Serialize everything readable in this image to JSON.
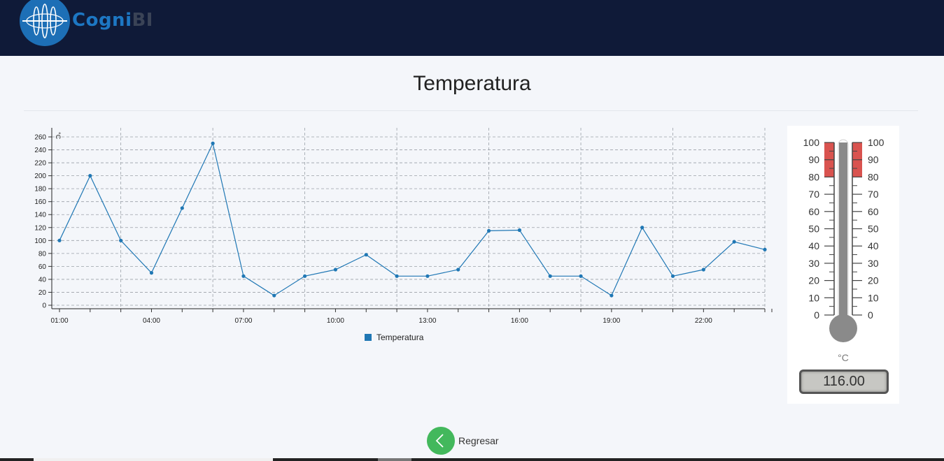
{
  "header": {
    "logo_text_primary": "Cogni",
    "logo_text_secondary": "BI",
    "logo_icon": "cognibi-logo-icon"
  },
  "page": {
    "title": "Temperatura"
  },
  "chart_data": {
    "type": "line",
    "title": "",
    "ylabel": "°C",
    "xlabel": "",
    "ylim": [
      0,
      260
    ],
    "yticks": [
      0,
      20,
      40,
      60,
      80,
      100,
      120,
      140,
      160,
      180,
      200,
      220,
      240,
      260
    ],
    "x": [
      "01:00",
      "02:00",
      "03:00",
      "04:00",
      "05:00",
      "06:00",
      "07:00",
      "08:00",
      "09:00",
      "10:00",
      "11:00",
      "12:00",
      "13:00",
      "14:00",
      "15:00",
      "16:00",
      "17:00",
      "18:00",
      "19:00",
      "20:00",
      "21:00",
      "22:00",
      "23:00",
      "24:00"
    ],
    "xtick_labels": [
      "01:00",
      "04:00",
      "07:00",
      "10:00",
      "13:00",
      "16:00",
      "19:00",
      "22:00"
    ],
    "series": [
      {
        "name": "Temperatura",
        "color": "#1f77b4",
        "values": [
          100,
          200,
          100,
          50,
          150,
          250,
          45,
          15,
          45,
          55,
          78,
          45,
          45,
          55,
          115,
          116,
          45,
          45,
          15,
          120,
          45,
          55,
          98,
          86
        ]
      }
    ],
    "grid": true,
    "legend": "bottom-center"
  },
  "gauge": {
    "unit": "°C",
    "value": "116.00",
    "min": 0,
    "max": 100,
    "level": 100,
    "ticks": [
      0,
      10,
      20,
      30,
      40,
      50,
      60,
      70,
      80,
      90,
      100
    ],
    "alert_from": 80,
    "alert_color": "#d9534f",
    "mercury_color": "#8a8a8a"
  },
  "back_button": {
    "label": "Regresar",
    "icon": "chevron-left-icon",
    "color": "#43b85c"
  }
}
